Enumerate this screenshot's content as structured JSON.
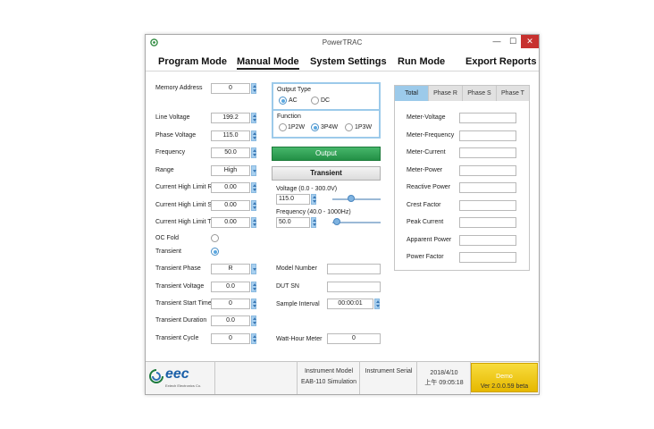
{
  "window": {
    "title": "PowerTRAC"
  },
  "titlebar": {
    "minimize": "—",
    "maximize": "☐",
    "close": "✕"
  },
  "menu": [
    {
      "label": "Program Mode"
    },
    {
      "label": "Manual Mode"
    },
    {
      "label": "System Settings"
    },
    {
      "label": "Run Mode"
    },
    {
      "label": "Export Reports"
    }
  ],
  "left": {
    "memory_address": {
      "label": "Memory Address",
      "value": "0"
    },
    "line_voltage": {
      "label": "Line Voltage",
      "value": "199.2"
    },
    "phase_voltage": {
      "label": "Phase Voltage",
      "value": "115.0"
    },
    "frequency": {
      "label": "Frequency",
      "value": "50.0"
    },
    "range": {
      "label": "Range",
      "value": "High"
    },
    "current_high_limit_r": {
      "label": "Current High Limit R",
      "value": "0.00"
    },
    "current_high_limit_s": {
      "label": "Current High Limit S",
      "value": "0.00"
    },
    "current_high_limit_t": {
      "label": "Current High Limit T",
      "value": "0.00"
    },
    "oc_fold": {
      "label": "OC Fold"
    },
    "transient": {
      "label": "Transient"
    },
    "transient_phase": {
      "label": "Transient Phase",
      "value": "R"
    },
    "transient_voltage": {
      "label": "Transient Voltage",
      "value": "0.0"
    },
    "transient_start_time": {
      "label": "Transient Start Time",
      "value": "0"
    },
    "transient_duration": {
      "label": "Transient Duration",
      "value": "0.0"
    },
    "transient_cycle": {
      "label": "Transient Cycle",
      "value": "0"
    }
  },
  "center": {
    "output_type": {
      "label": "Output Type",
      "options": [
        "AC",
        "DC"
      ],
      "selected": "AC"
    },
    "function": {
      "label": "Function",
      "options": [
        "1P2W",
        "3P4W",
        "1P3W"
      ],
      "selected": "3P4W"
    },
    "output_button": "Output",
    "transient_button": "Transient",
    "voltage_slider": {
      "label": "Voltage (0.0 - 300.0V)",
      "value": "115.0",
      "level": 0.38
    },
    "frequency_slider": {
      "label": "Frequency (40.0 - 1000Hz)",
      "value": "50.0",
      "level": 0.01
    },
    "model_number": {
      "label": "Model Number",
      "value": ""
    },
    "dut_sn": {
      "label": "DUT SN",
      "value": ""
    },
    "sample_interval": {
      "label": "Sample Interval",
      "value": "00:00:01"
    },
    "watt_hour_meter": {
      "label": "Watt-Hour Meter",
      "value": "0"
    }
  },
  "tabs": [
    {
      "label": "Total"
    },
    {
      "label": "Phase R"
    },
    {
      "label": "Phase S"
    },
    {
      "label": "Phase T"
    }
  ],
  "meters": [
    {
      "label": "Meter-Voltage",
      "value": ""
    },
    {
      "label": "Meter-Frequency",
      "value": ""
    },
    {
      "label": "Meter-Current",
      "value": ""
    },
    {
      "label": "Meter-Power",
      "value": ""
    },
    {
      "label": "Reactive Power",
      "value": ""
    },
    {
      "label": "Crest Factor",
      "value": ""
    },
    {
      "label": "Peak Current",
      "value": ""
    },
    {
      "label": "Apparent Power",
      "value": ""
    },
    {
      "label": "Power Factor",
      "value": ""
    }
  ],
  "status": {
    "logo_text": "eec",
    "logo_subtext": "Extech Electronics Co.",
    "instrument_model_label": "Instrument Model",
    "instrument_model_value": "EAB-110 Simulation",
    "instrument_serial_label": "Instrument Serial",
    "date": "2018/4/10",
    "time": "上午 09:05:18",
    "demo_label": "Demo",
    "version": "Ver 2.0.0.59 beta"
  },
  "colors": {
    "accent": "#9ccaea",
    "output_green": "#239046",
    "close_red": "#c7312f",
    "demo_yellow": "#f1cb1a"
  }
}
